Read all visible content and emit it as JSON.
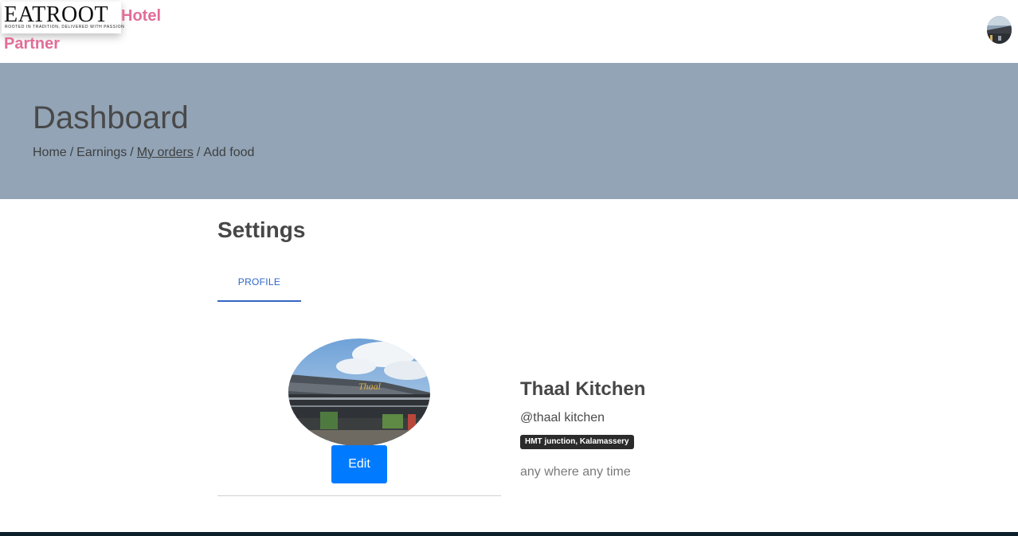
{
  "header": {
    "logo_wordmark": "EATROOT",
    "logo_tagline": "ROOTED IN TRADITION, DELIVERED WITH PASSION",
    "brand_suffix_line1": "Hotel",
    "brand_suffix_line2": "Partner",
    "avatar_icon": "user-avatar-photo"
  },
  "hero": {
    "title": "Dashboard",
    "breadcrumb": {
      "home": "Home",
      "earnings": "Earnings",
      "my_orders": "My orders",
      "add_food": "Add food",
      "separator": "/"
    }
  },
  "settings": {
    "title": "Settings",
    "tabs": [
      {
        "label": "PROFILE",
        "active": true
      }
    ]
  },
  "profile": {
    "name": "Thaal Kitchen",
    "handle": "@thaal kitchen",
    "location": "HMT junction, Kalamassery",
    "tagline": "any where any time",
    "edit_label": "Edit",
    "photo_sign": "Thaal"
  },
  "colors": {
    "brand_pink": "#e26d98",
    "hero_bg": "#92a4b6",
    "tab_accent": "#3667c4",
    "button_blue": "#007bff"
  }
}
